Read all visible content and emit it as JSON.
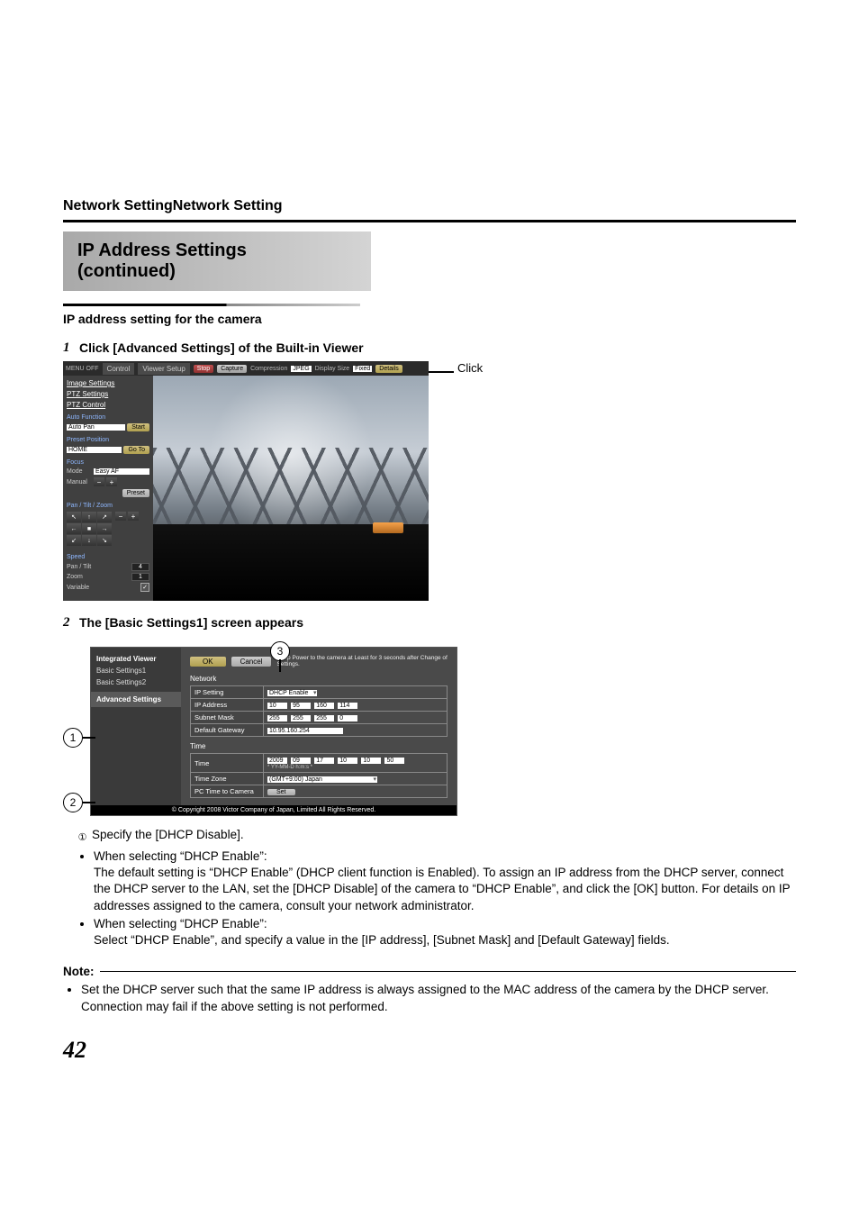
{
  "section_header": "Network SettingNetwork Setting",
  "title_line1": "IP Address Settings",
  "title_line2": "(continued)",
  "subheading": "IP address setting for the camera",
  "step1_num": "1",
  "step1_text": "Click [Advanced Settings] of the Built-in Viewer",
  "click_label": "Click",
  "viewer1": {
    "menu_off": "MENU  OFF",
    "tab_control": "Control",
    "tab_viewer_setup": "Viewer Setup",
    "btn_stop": "Stop",
    "btn_capture": "Capture",
    "lbl_compression": "Compression",
    "sel_compression": "JPEG",
    "lbl_display_size": "Display Size",
    "sel_display_size": "Fixed",
    "btn_details": "Details",
    "side_links": {
      "image_settings": "Image Settings",
      "ptz_settings": "PTZ Settings",
      "ptz_control": "PTZ Control"
    },
    "grp_auto_function": "Auto Function",
    "sel_auto_pan": "Auto Pan",
    "btn_start": "Start",
    "grp_preset_position": "Preset Position",
    "sel_home": "HOME",
    "btn_goto": "Go To",
    "grp_focus": "Focus",
    "lbl_mode": "Mode",
    "sel_easy_af": "Easy AF",
    "lbl_manual": "Manual",
    "btn_preset": "Preset",
    "grp_ptz": "Pan / Tilt / Zoom",
    "grp_speed": "Speed",
    "lbl_pan_tilt": "Pan / Tilt",
    "val_pan_tilt": "4",
    "lbl_zoom": "Zoom",
    "val_zoom": "1",
    "lbl_variable": "Variable"
  },
  "step2_num": "2",
  "step2_text": "The [Basic Settings1] screen appears",
  "viewer2": {
    "side": {
      "integrated_viewer": "Integrated Viewer",
      "basic_settings1": "Basic Settings1",
      "basic_settings2": "Basic Settings2",
      "advanced_settings": "Advanced Settings"
    },
    "btn_ok": "OK",
    "btn_cancel": "Cancel",
    "top_note": "Keep Power to the camera at Least for 3 seconds after Change of Settings.",
    "sect_network": "Network",
    "row_ip_setting": "IP Setting",
    "val_ip_setting": "DHCP Enable",
    "row_ip_address": "IP Address",
    "ip_a": "10",
    "ip_b": "95",
    "ip_c": "160",
    "ip_d": "114",
    "row_subnet": "Subnet Mask",
    "sm_a": "255",
    "sm_b": "255",
    "sm_c": "255",
    "sm_d": "0",
    "row_gateway": "Default Gateway",
    "val_gateway": "10.95.160.254",
    "sect_time": "Time",
    "row_time": "Time",
    "time_year": "2009",
    "time_mon": "09",
    "time_day": "17",
    "time_h": "10",
    "time_m": "10",
    "time_s": "50",
    "time_note": "* YY-MM-D h:m:s *",
    "row_tz": "Time Zone",
    "val_tz": "(GMT+9:00) Japan",
    "row_pc_time": "PC Time to Camera",
    "btn_set": "Set",
    "copyright": "© Copyright 2008 Victor Company of Japan, Limited All Rights Reserved."
  },
  "callouts": {
    "c1": "1",
    "c2": "2",
    "c3": "3"
  },
  "body": {
    "l1": "Specify the [DHCP Disable].",
    "b1_head": "When selecting “DHCP Enable”:",
    "b1_body": "The default setting is “DHCP Enable” (DHCP client function is Enabled). To assign an IP address from the DHCP server, connect the DHCP server to the LAN, set the [DHCP Disable] of the camera to “DHCP Enable”, and click the [OK] button. For details on IP addresses assigned to the camera, consult your network administrator.",
    "b2_head": "When selecting “DHCP Enable”:",
    "b2_body": "Select “DHCP Enable”, and specify a value in the [IP address], [Subnet Mask] and [Default Gateway] fields."
  },
  "note_label": "Note:",
  "note_body": "Set the DHCP server such that the same IP address is always assigned to the MAC address of the camera by the DHCP server. Connection may fail if the above setting is not performed.",
  "page_number": "42"
}
